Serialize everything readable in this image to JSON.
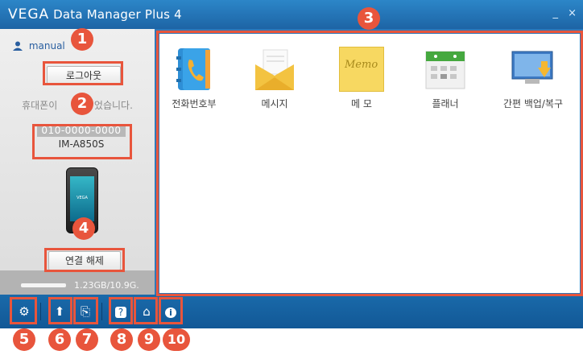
{
  "window": {
    "title_brand": "VEGA",
    "title_text": "Data Manager Plus 4",
    "minimize_glyph": "_",
    "close_glyph": "×"
  },
  "sidebar": {
    "username": "manual",
    "logout_label": "로그아웃",
    "status_text_left": "휴대폰이",
    "status_text_right": "었습니다.",
    "phone_number": "010-0000-0000",
    "phone_model": "IM-A850S",
    "device_brand": "VEGA",
    "disconnect_label": "연결 해제",
    "storage_text": "1.23GB/10.9G.",
    "storage_used_fraction": 0.11
  },
  "apps": [
    {
      "label": "전화번호부",
      "icon": "phonebook-icon"
    },
    {
      "label": "메시지",
      "icon": "message-icon"
    },
    {
      "label": "메 모",
      "icon": "memo-icon"
    },
    {
      "label": "플래너",
      "icon": "planner-icon"
    },
    {
      "label": "간편 백업/복구",
      "icon": "backup-icon"
    }
  ],
  "memo_icon_text": "Memo",
  "toolbar": [
    {
      "name": "settings-icon",
      "glyph": "⚙"
    },
    {
      "name": "upload-icon",
      "glyph": "⬆"
    },
    {
      "name": "export-icon",
      "glyph": "⎘"
    },
    {
      "name": "help-icon",
      "glyph": "?"
    },
    {
      "name": "home-icon",
      "glyph": "⌂"
    },
    {
      "name": "info-icon",
      "glyph": "i"
    }
  ],
  "callouts": [
    "1",
    "2",
    "3",
    "4",
    "5",
    "6",
    "7",
    "8",
    "9",
    "10"
  ],
  "colors": {
    "accent": "#e8553c",
    "titlebar": "#1d64a5",
    "bottombar": "#125896"
  }
}
